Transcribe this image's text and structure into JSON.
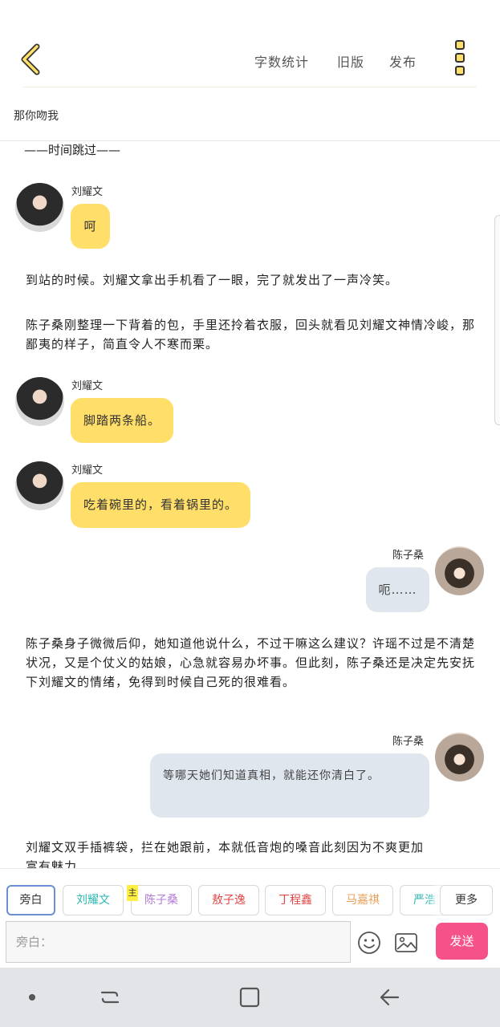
{
  "header": {
    "word_count_label": "字数统计",
    "old_version_label": "旧版",
    "publish_label": "发布"
  },
  "story_title": "那你吻我",
  "timeline": {
    "divider": "——时间跳过——",
    "messages": [
      {
        "speaker": "刘耀文",
        "text": "呵"
      },
      {
        "speaker": "刘耀文",
        "text": "脚踏两条船。"
      },
      {
        "speaker": "刘耀文",
        "text": "吃着碗里的，看着锅里的。"
      },
      {
        "speaker": "陈子桑",
        "text": "呃……"
      },
      {
        "speaker": "陈子桑",
        "text": "等哪天她们知道真相，就能还你清白了。"
      }
    ],
    "narration": [
      "到站的时候。刘耀文拿出手机看了一眼，完了就发出了一声冷笑。",
      "陈子桑刚整理一下背着的包，手里还拎着衣服，回头就看见刘耀文神情冷峻，那鄙夷的样子，简直令人不寒而栗。",
      "陈子桑身子微微后仰，她知道他说什么，不过干嘛这么建议？许瑶不过是不清楚状况，又是个仗义的姑娘，心急就容易办坏事。但此刻，陈子桑还是决定先安抚下刘耀文的情绪，免得到时候自己死的很难看。",
      "刘耀文双手插裤袋，拦在她跟前，本就低音炮的嗓音此刻因为不爽更加富有魅力"
    ]
  },
  "characters": {
    "chips": [
      {
        "label": "旁白",
        "color": "#333333"
      },
      {
        "label": "刘耀文",
        "color": "#2BB7B0"
      },
      {
        "label": "陈子桑",
        "color": "#B57BD8"
      },
      {
        "label": "敖子逸",
        "color": "#E04646"
      },
      {
        "label": "丁程鑫",
        "color": "#E04646"
      },
      {
        "label": "马嘉祺",
        "color": "#E8A15A"
      },
      {
        "label": "严浩翔",
        "color": "#2BB7B0"
      }
    ],
    "main_badge": "主",
    "more_label": "更多"
  },
  "composer": {
    "placeholder": "旁白：",
    "send_label": "发送"
  }
}
